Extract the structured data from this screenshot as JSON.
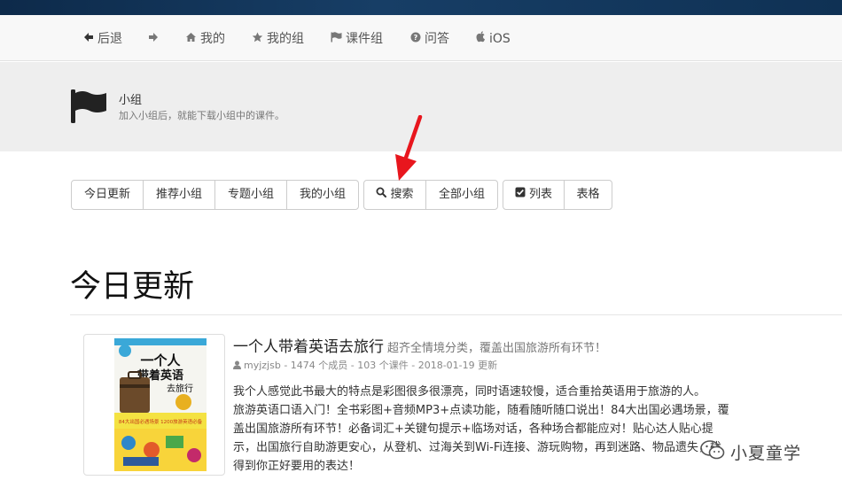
{
  "nav": {
    "items": [
      {
        "label": "后退",
        "icon": "arrow-left-icon"
      },
      {
        "label": "",
        "icon": "arrow-right-icon"
      },
      {
        "label": "我的",
        "icon": "home-icon"
      },
      {
        "label": "我的组",
        "icon": "star-icon"
      },
      {
        "label": "课件组",
        "icon": "flag-icon"
      },
      {
        "label": "问答",
        "icon": "question-circle-icon"
      },
      {
        "label": "iOS",
        "icon": "apple-icon"
      }
    ]
  },
  "jumbotron": {
    "title": "小组",
    "subtitle": "加入小组后，就能下载小组中的课件。",
    "icon": "flag-icon"
  },
  "filters": {
    "group1": [
      "今日更新",
      "推荐小组",
      "专题小组",
      "我的小组"
    ],
    "group2": [
      {
        "label": "搜索",
        "icon": "search-icon"
      },
      {
        "label": "全部小组",
        "icon": ""
      }
    ],
    "group3": [
      {
        "label": "列表",
        "icon": "check-square-icon"
      },
      {
        "label": "表格",
        "icon": ""
      }
    ]
  },
  "page": {
    "heading": "今日更新"
  },
  "listing": {
    "title": "一个人带着英语去旅行",
    "subtitle": "超齐全情境分类，覆盖出国旅游所有环节！",
    "meta": "myjzjsb - 1474 个成员 - 103 个课件 - 2018-01-19 更新",
    "description": [
      "我个人感觉此书最大的特点是彩图很多很漂亮，同时语速较慢，适合重拾英语用于旅游的人。",
      "旅游英语口语入门！全书彩图+音频MP3+点读功能，随看随听随口说出！84大出国必遇场景，覆盖出国旅游所有环节！必备词汇+关键句提示+临场对话，各种场合都能应对！贴心达人贴心提示，出国旅行自助游更安心，从登机、过海关到Wi-Fi连接、游玩购物，再到迷路、物品遗失，找得到你正好要用的表达！"
    ],
    "cover": {
      "line1": "一个人",
      "line2": "带着英语",
      "line3": "去旅行",
      "banner": "84大出国必遇场景 1200旅游英语必备"
    }
  },
  "watermark": {
    "text": "小夏童学"
  },
  "colors": {
    "topbar": "#123a60",
    "annotation_arrow": "#e8161d",
    "jumbotron_bg": "#eeeeee"
  }
}
